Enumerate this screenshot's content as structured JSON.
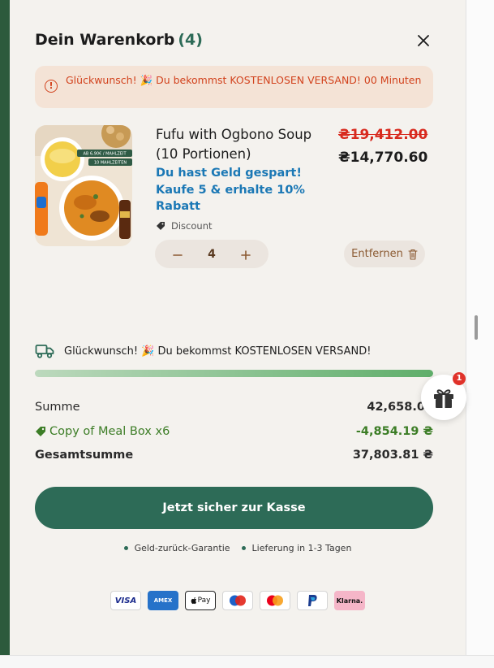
{
  "cart": {
    "title": "Dein Warenkorb",
    "count": "(4)"
  },
  "alert": {
    "text": "Glückwunsch! 🎉 Du bekommst KOSTENLOSEN VERSAND! 00 Minuten"
  },
  "item": {
    "title": "Fufu with Ogbono Soup (10 Portionen)",
    "price_old": "₴19,412.00",
    "price_new": "₴14,770.60",
    "promo": "Du hast Geld gespart! Kaufe 5 & erhalte 10% Rabatt",
    "discount_label": "Discount",
    "quantity": "4",
    "remove_label": "Entfernen",
    "image_badge_1": "AB 6,90€ / MAHLZEIT",
    "image_badge_2": "10 MAHLZEITEN"
  },
  "shipping": {
    "text": "Glückwunsch! 🎉 Du bekommst KOSTENLOSEN VERSAND!",
    "progress": 1.0
  },
  "gift": {
    "badge": "1"
  },
  "totals": {
    "sum_label": "Summe",
    "sum_value": "42,658.00",
    "discount_label": "Copy of Meal Box x6",
    "discount_value": "-4,854.19 ₴",
    "total_label": "Gesamtsumme",
    "total_value": "37,803.81 ₴"
  },
  "checkout": {
    "label": "Jetzt sicher zur Kasse"
  },
  "guarantees": [
    "Geld-zurück-Garantie",
    "Lieferung in 1-3 Tagen"
  ],
  "payments": {
    "visa": "VISA",
    "amex": "AMEX",
    "applepay": "Pay",
    "klarna": "Klarna."
  },
  "colors": {
    "brand_green": "#2d6b57",
    "alert_red": "#d2431e",
    "promo_blue": "#1b78b5",
    "discount_green": "#3c7d26"
  }
}
